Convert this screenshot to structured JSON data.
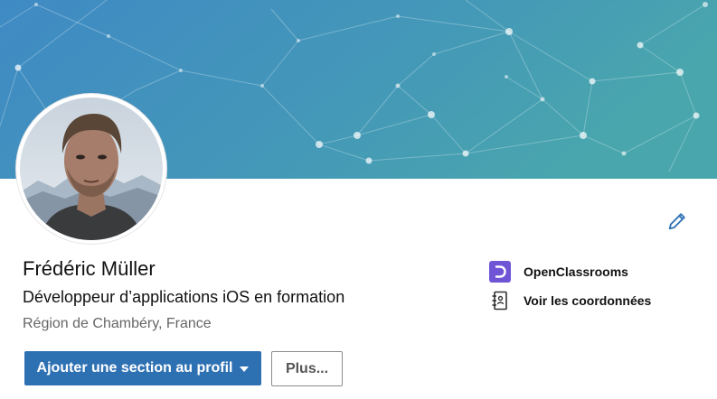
{
  "profile": {
    "name": "Frédéric Müller",
    "headline": "Développeur d’applications iOS en formation",
    "location": "Région de Chambéry, France"
  },
  "actions": {
    "add_section_label": "Ajouter une section au profil",
    "more_label": "Plus..."
  },
  "sidebar": {
    "company_label": "OpenClassrooms",
    "contact_label": "Voir les coordonnées"
  },
  "icons": {
    "edit": "pencil-icon",
    "company": "openclassrooms-logo",
    "contact": "address-book-icon"
  },
  "colors": {
    "banner_start": "#3f8fc3",
    "banner_end": "#47a3ad",
    "primary_button": "#2e71b3",
    "edit_icon": "#2e71b3",
    "oc_logo": "#6f55d6"
  }
}
